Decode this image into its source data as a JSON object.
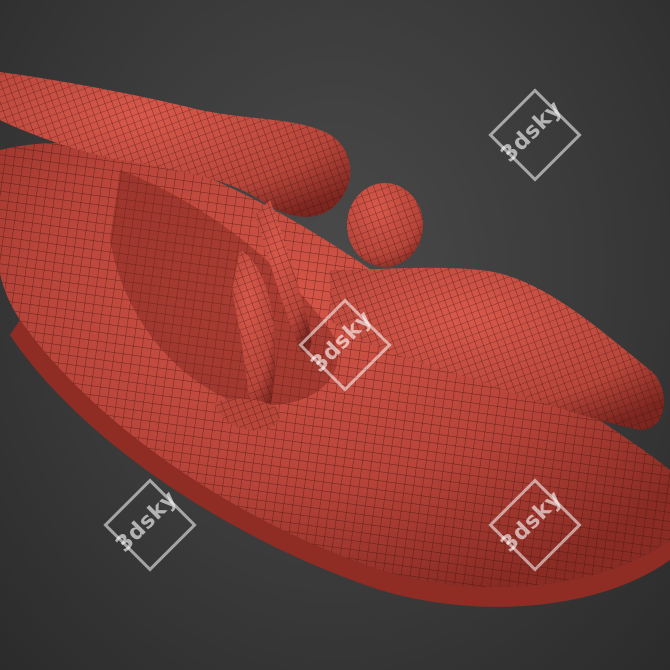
{
  "image": {
    "subject": "",
    "watermark_text": "3dsky",
    "watermark_count": 4,
    "colors": {
      "background": "#3a3a3a",
      "mesh_fill": "#c84a3e",
      "mesh_dark": "#7a231c",
      "wireframe": "#2a0e0b"
    }
  }
}
